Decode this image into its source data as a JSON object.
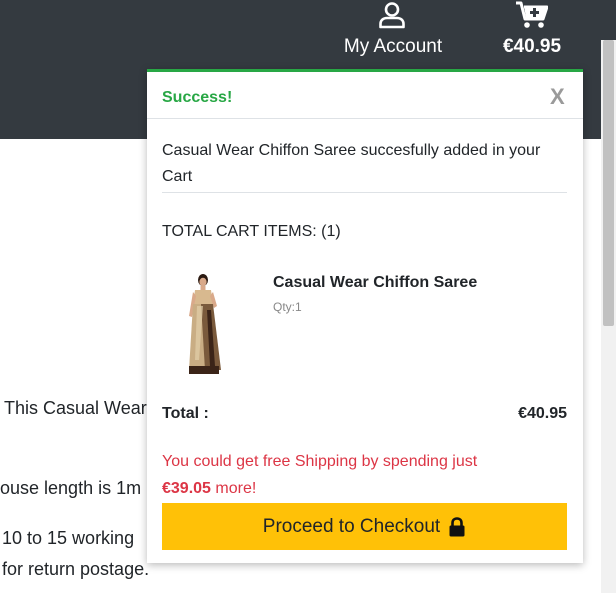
{
  "header": {
    "account_label": "My Account",
    "cart_total": "€40.95"
  },
  "background_text": {
    "line1": "This Casual Wear",
    "line2": "ouse length is 1m",
    "line3": "10 to 15 working",
    "line4": "for return postage."
  },
  "popup": {
    "title": "Success!",
    "close_label": "X",
    "message": "Casual Wear Chiffon Saree succesfully added in your Cart",
    "total_items": "TOTAL CART ITEMS: (1)",
    "item": {
      "name": "Casual Wear Chiffon Saree",
      "qty": "Qty:1"
    },
    "total_label": "Total :",
    "total_value": "€40.95",
    "shipping_text": "You could get free Shipping by spending just",
    "shipping_amount": "€39.05",
    "shipping_suffix": "more!",
    "checkout_label": "Proceed to Checkout"
  },
  "colors": {
    "topbar": "#343a40",
    "success": "#28a745",
    "alert": "#dc3545",
    "checkout": "#ffc107"
  },
  "icons": {
    "account": "user-icon",
    "cart": "cart-icon",
    "close": "close-icon",
    "lock": "lock-icon"
  }
}
